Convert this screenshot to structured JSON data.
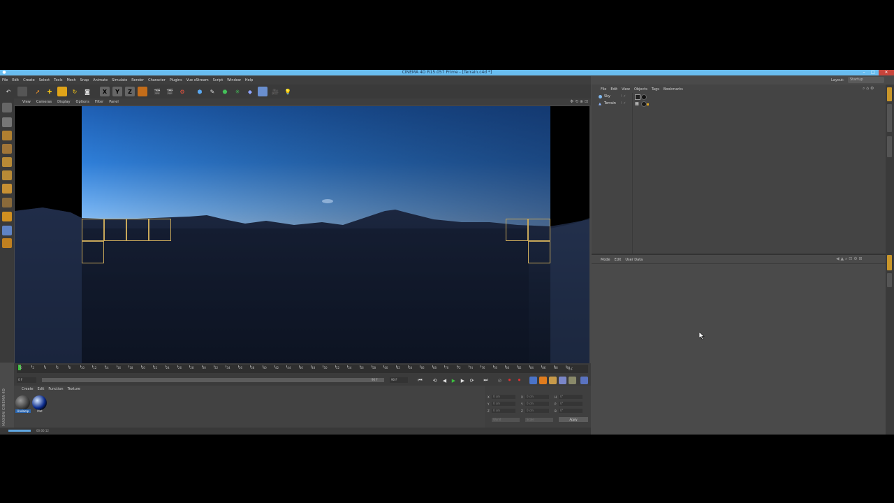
{
  "window": {
    "title": "CINEMA 4D R15.057 Prime - [Terrain.c4d *]"
  },
  "menu": [
    "File",
    "Edit",
    "Create",
    "Select",
    "Tools",
    "Mesh",
    "Snap",
    "Animate",
    "Simulate",
    "Render",
    "Character",
    "Plugins",
    "Vue xStream",
    "Script",
    "Window",
    "Help"
  ],
  "layout": {
    "label": "Layout:",
    "value": "Startup"
  },
  "viewport_menu": [
    "View",
    "Cameras",
    "Display",
    "Options",
    "Filter",
    "Panel"
  ],
  "object_manager": {
    "menu": [
      "File",
      "Edit",
      "View",
      "Objects",
      "Tags",
      "Bookmarks"
    ],
    "objects": [
      {
        "name": "Sky"
      },
      {
        "name": "Terrain"
      }
    ]
  },
  "attribute_manager": {
    "menu": [
      "Mode",
      "Edit",
      "User Data"
    ]
  },
  "timeline": {
    "ticks": [
      "0",
      "2",
      "4",
      "6",
      "8",
      "10",
      "12",
      "14",
      "16",
      "18",
      "20",
      "22",
      "24",
      "26",
      "28",
      "30",
      "32",
      "34",
      "36",
      "38",
      "40",
      "42",
      "44",
      "46",
      "48",
      "50",
      "52",
      "54",
      "56",
      "58",
      "60",
      "62",
      "64",
      "66",
      "68",
      "70",
      "72",
      "74",
      "76",
      "78",
      "80",
      "82",
      "84",
      "86",
      "88",
      "90"
    ],
    "end_label": "0 F",
    "start_field": "0 F",
    "end_field": "90 F",
    "max_field": "90 F"
  },
  "material_manager": {
    "menu": [
      "Create",
      "Edit",
      "Function",
      "Texture"
    ],
    "materials": [
      "Undamp",
      "Mat"
    ]
  },
  "coordinates": {
    "rows": [
      {
        "a": "X",
        "av": "0 cm",
        "b": "X",
        "bv": "0 cm",
        "c": "H",
        "cv": "0°"
      },
      {
        "a": "Y",
        "av": "0 cm",
        "b": "Y",
        "bv": "0 cm",
        "c": "P",
        "cv": "0°"
      },
      {
        "a": "Z",
        "av": "0 cm",
        "b": "Z",
        "bv": "0 cm",
        "c": "B",
        "cv": "0°"
      }
    ],
    "mode1": "World",
    "mode2": "Scale",
    "apply": "Apply"
  },
  "status": {
    "time": "00:00:12"
  },
  "brand": "MAXON CINEMA 4D",
  "colors": {
    "titlebar": "#69bdf0",
    "panel": "#4a4a4a",
    "accent_yellow": "#c8a85a"
  }
}
